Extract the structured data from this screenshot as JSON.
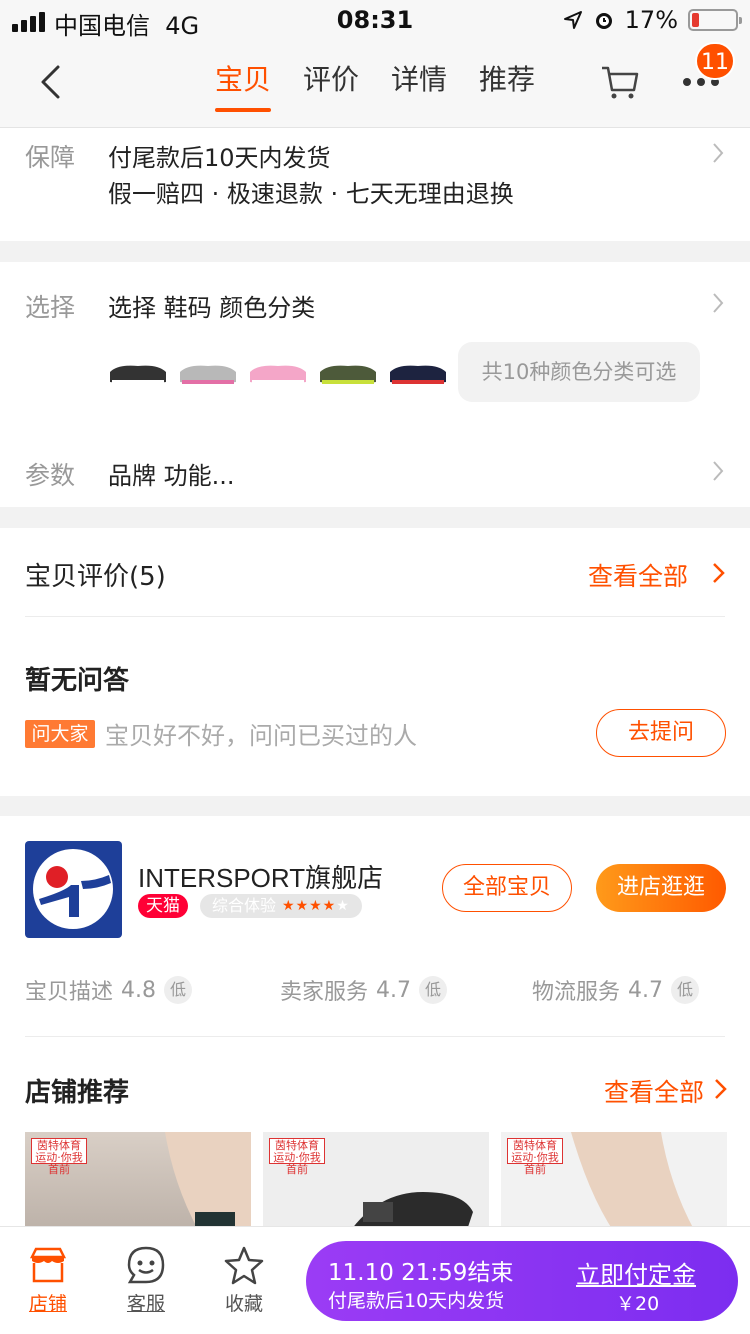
{
  "status": {
    "carrier": "中国电信",
    "network": "4G",
    "time": "08:31",
    "battery_percent": "17%",
    "battery_level": 0.17
  },
  "nav": {
    "tabs": [
      "宝贝",
      "评价",
      "详情",
      "推荐"
    ],
    "active_tab": 0,
    "badge_count": "11"
  },
  "guarantee": {
    "label": "保障",
    "line1": "付尾款后10天内发货",
    "line2": "假一赔四 · 极速退款 · 七天无理由退换"
  },
  "select": {
    "label": "选择",
    "text": "选择 鞋码 颜色分类",
    "more_colors": "共10种颜色分类可选",
    "thumb_colors": [
      "#3a3a3a",
      "#b8b8b8",
      "#f4a6c8",
      "#4d5a3a",
      "#1d2340"
    ],
    "param_label": "参数",
    "param_text": "品牌 功能..."
  },
  "reviews": {
    "title": "宝贝评价(5)",
    "see_all": "查看全部"
  },
  "qa": {
    "title": "暂无问答",
    "tag": "问大家",
    "hint": "宝贝好不好，问问已买过的人",
    "ask_button": "去提问"
  },
  "shop": {
    "name": "INTERSPORT旗舰店",
    "tmall": "天猫",
    "experience": "综合体验",
    "experience_stars": 4,
    "all_items": "全部宝贝",
    "enter_shop": "进店逛逛",
    "scores": [
      {
        "label": "宝贝描述",
        "value": "4.8",
        "level": "低"
      },
      {
        "label": "卖家服务",
        "value": "4.7",
        "level": "低"
      },
      {
        "label": "物流服务",
        "value": "4.7",
        "level": "低"
      }
    ],
    "recommend_title": "店铺推荐",
    "recommend_see_all": "查看全部",
    "rec_badge_line1": "茵特体育",
    "rec_badge_line2": "运动·你我首前"
  },
  "bottom": {
    "shop": "店铺",
    "service": "客服",
    "favorite": "收藏",
    "presale_time": "11.10 21:59结束",
    "presale_ship": "付尾款后10天内发货",
    "pay_deposit": "立即付定金",
    "deposit": "￥20"
  },
  "colors": {
    "accent": "#ff5000",
    "presale": "#8a35f2",
    "tmall": "#ff0036"
  }
}
